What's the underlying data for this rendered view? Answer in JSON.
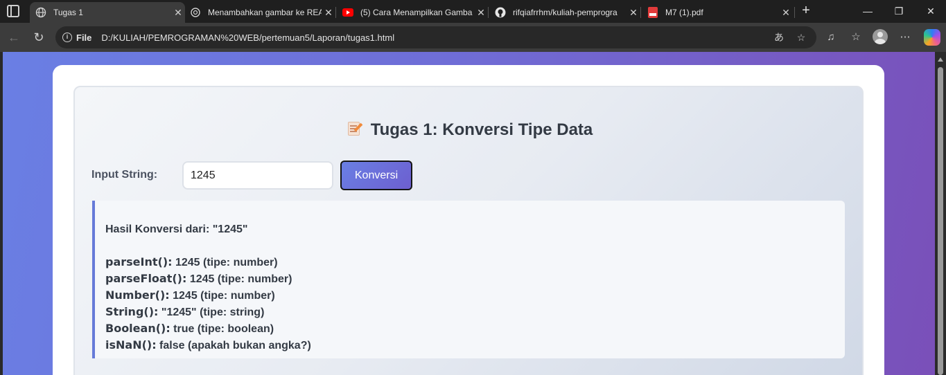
{
  "browser": {
    "tabs": [
      {
        "title": "Tugas 1",
        "icon": "globe-icon"
      },
      {
        "title": "Menambahkan gambar ke REA",
        "icon": "chatgpt-icon"
      },
      {
        "title": "(5) Cara Menampilkan Gamba",
        "icon": "youtube-icon"
      },
      {
        "title": "rifqiafrrhm/kuliah-pemprogra",
        "icon": "github-icon"
      },
      {
        "title": "M7 (1).pdf",
        "icon": "pdf-icon"
      }
    ],
    "address": {
      "chip": "File",
      "url": "D:/KULIAH/PEMROGRAMAN%20WEB/pertemuan5/Laporan/tugas1.html"
    }
  },
  "page": {
    "heading": "Tugas 1: Konversi Tipe Data",
    "input_label": "Input String:",
    "input_value": "1245",
    "button_label": "Konversi",
    "result": {
      "title": "Hasil Konversi dari: \"1245\"",
      "rows": [
        {
          "fn": "parseInt():",
          "val": " 1245 (tipe: number)"
        },
        {
          "fn": "parseFloat():",
          "val": " 1245 (tipe: number)"
        },
        {
          "fn": "Number():",
          "val": " 1245 (tipe: number)"
        },
        {
          "fn": "String():",
          "val": " \"1245\" (tipe: string)"
        },
        {
          "fn": "Boolean():",
          "val": " true (tipe: boolean)"
        },
        {
          "fn": "isNaN():",
          "val": " false (apakah bukan angka?)"
        }
      ]
    }
  },
  "colors": {
    "accent": "#667ad8",
    "button_start": "#6a7fe4",
    "button_end": "#6d5fcf",
    "page_bg_start": "#6a7fe4",
    "page_bg_end": "#7a4fb8"
  }
}
